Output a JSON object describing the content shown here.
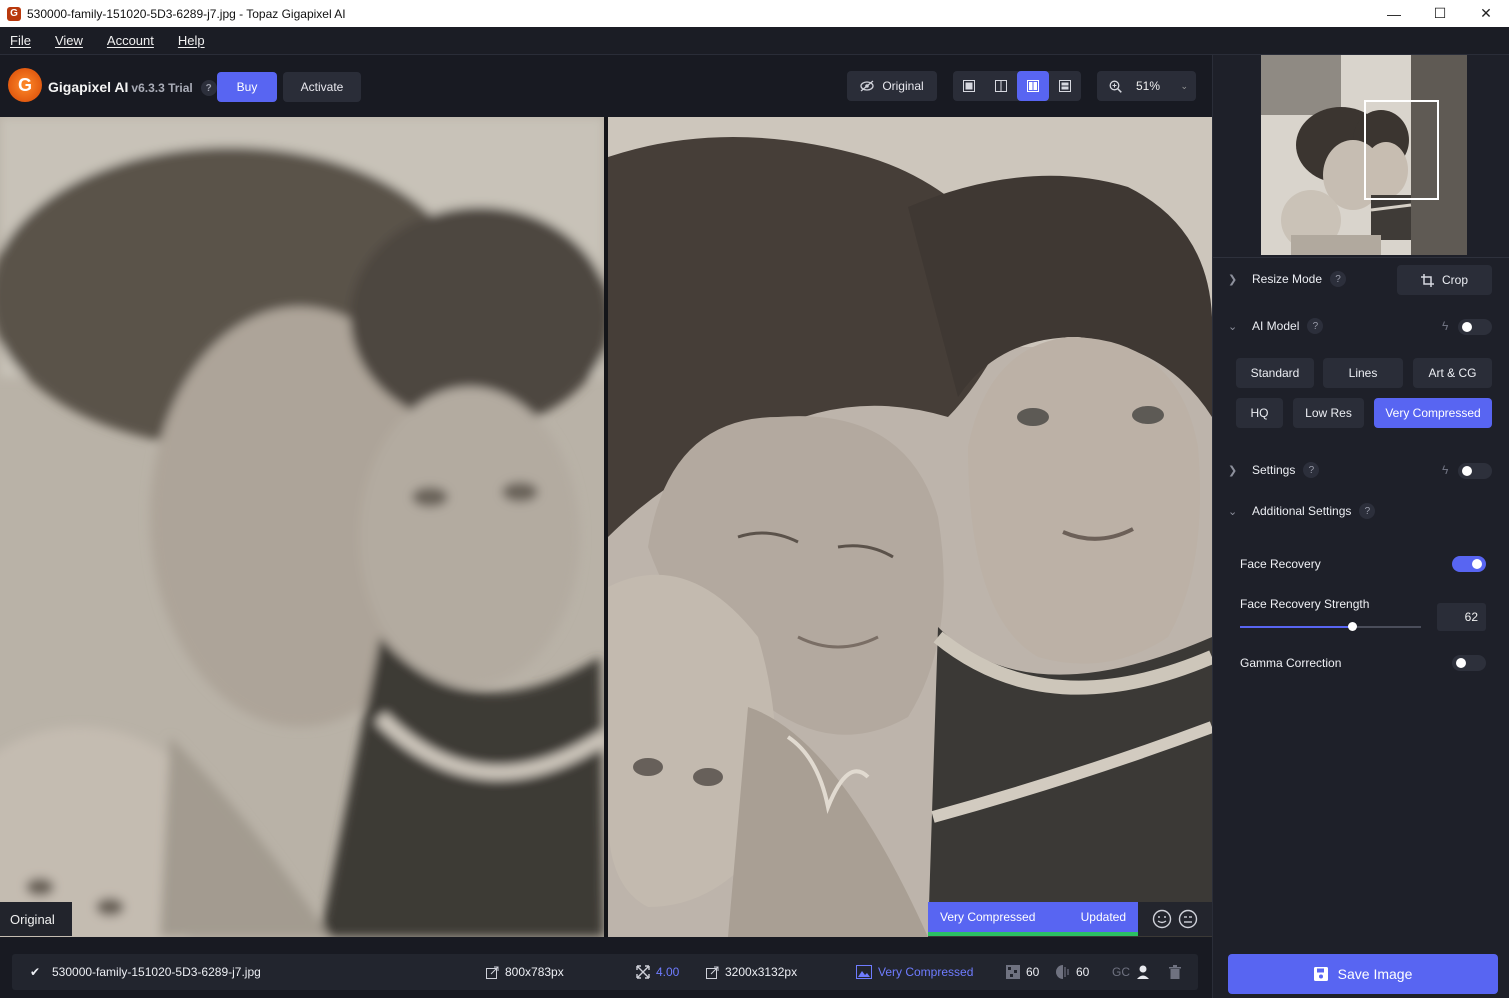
{
  "window": {
    "title": "530000-family-151020-5D3-6289-j7.jpg - Topaz Gigapixel AI",
    "minimize": "—",
    "maximize": "☐",
    "close": "✕"
  },
  "menu": [
    "File",
    "View",
    "Account",
    "Help"
  ],
  "toolbar": {
    "app_name": "Gigapixel AI",
    "version": "v6.3.3 Trial",
    "help": "?",
    "buy_label": "Buy",
    "activate_label": "Activate",
    "original_label": "Original",
    "zoom": "51%",
    "accent_color": "#5865f2"
  },
  "preview": {
    "original_label": "Original",
    "model_status": "Very Compressed",
    "update_status": "Updated"
  },
  "panel": {
    "resize_mode": {
      "label": "Resize Mode",
      "help": "?",
      "crop_label": "Crop"
    },
    "ai_model": {
      "label": "AI Model",
      "help": "?",
      "toggle_on": false,
      "models": [
        "Standard",
        "Lines",
        "Art & CG",
        "HQ",
        "Low Res",
        "Very Compressed"
      ],
      "selected": "Very Compressed"
    },
    "settings": {
      "label": "Settings",
      "help": "?",
      "toggle_on": false
    },
    "additional_settings": {
      "label": "Additional Settings",
      "help": "?",
      "face_recovery": {
        "label": "Face Recovery",
        "on": true
      },
      "face_recovery_strength": {
        "label": "Face Recovery Strength",
        "value": "62",
        "fraction": 0.62
      },
      "gamma_correction": {
        "label": "Gamma Correction",
        "on": false
      }
    }
  },
  "bottom": {
    "filename": "530000-family-151020-5D3-6289-j7.jpg",
    "input_size": "800x783px",
    "scale": "4.00",
    "output_size": "3200x3132px",
    "model": "Very Compressed",
    "noise": "60",
    "blur": "60",
    "gc": "GC",
    "save_label": "Save Image"
  }
}
